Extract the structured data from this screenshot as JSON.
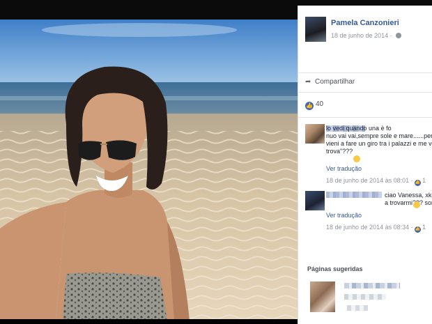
{
  "post": {
    "author": "Pamela Canzonieri",
    "date": "18 de junho de 2014 · "
  },
  "actions": {
    "share_label": "Compartilhar"
  },
  "likes": {
    "count": "40"
  },
  "comments": [
    {
      "text": "lo vedi quando una è fo\nnuo vai vai,sempre sole e mare......perc\nvieni a fare un giro tra i palazzi e me vie\ntrova\"???",
      "translate": "Ver tradução",
      "time": "18 de junho de 2014 às 08:01 · ",
      "likes": "1"
    },
    {
      "text": "ciao Vanessa, xkè n\na trovarmi??? sono in Sicilia...",
      "translate": "Ver tradução",
      "time": "18 de junho de 2014 às 08:34 · ",
      "likes": "1"
    }
  ],
  "suggested": {
    "title": "Páginas sugeridas"
  },
  "icons": {
    "share": "share-arrow-icon",
    "like": "thumbs-up-icon",
    "privacy": "globe-icon",
    "emoji": "smile-emoji-icon"
  },
  "colors": {
    "link": "#365899",
    "like": "#4267b2",
    "meta": "#90949c"
  }
}
